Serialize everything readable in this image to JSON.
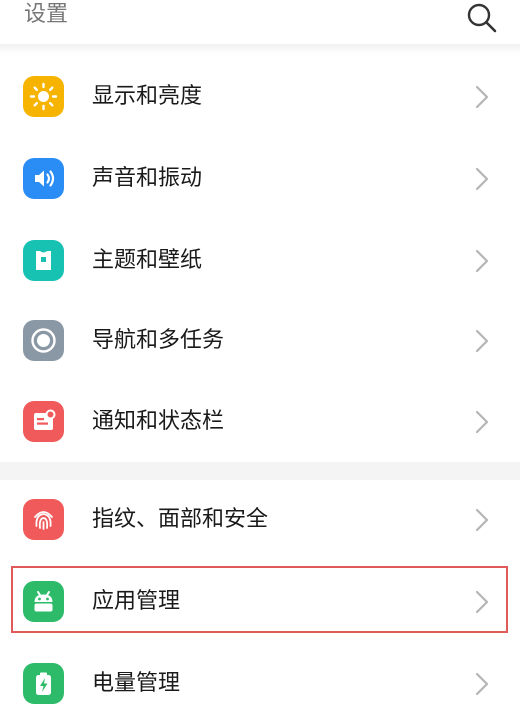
{
  "header": {
    "title": "设置",
    "search_icon": "search-icon"
  },
  "settings": {
    "items": [
      {
        "label": "显示和亮度",
        "icon": "sun-icon",
        "color": "#f6b400"
      },
      {
        "label": "声音和振动",
        "icon": "speaker-icon",
        "color": "#2a8df5"
      },
      {
        "label": "主题和壁纸",
        "icon": "shirt-icon",
        "color": "#18c2b2"
      },
      {
        "label": "导航和多任务",
        "icon": "navigation-circle-icon",
        "color": "#8a98a6"
      },
      {
        "label": "通知和状态栏",
        "icon": "notification-icon",
        "color": "#f05a5a"
      },
      {
        "label": "指纹、面部和安全",
        "icon": "fingerprint-icon",
        "color": "#f05a5a"
      },
      {
        "label": "应用管理",
        "icon": "android-icon",
        "color": "#2dbb6a"
      },
      {
        "label": "电量管理",
        "icon": "battery-icon",
        "color": "#2dbb6a"
      }
    ]
  },
  "highlight_color": "#e05a5a"
}
